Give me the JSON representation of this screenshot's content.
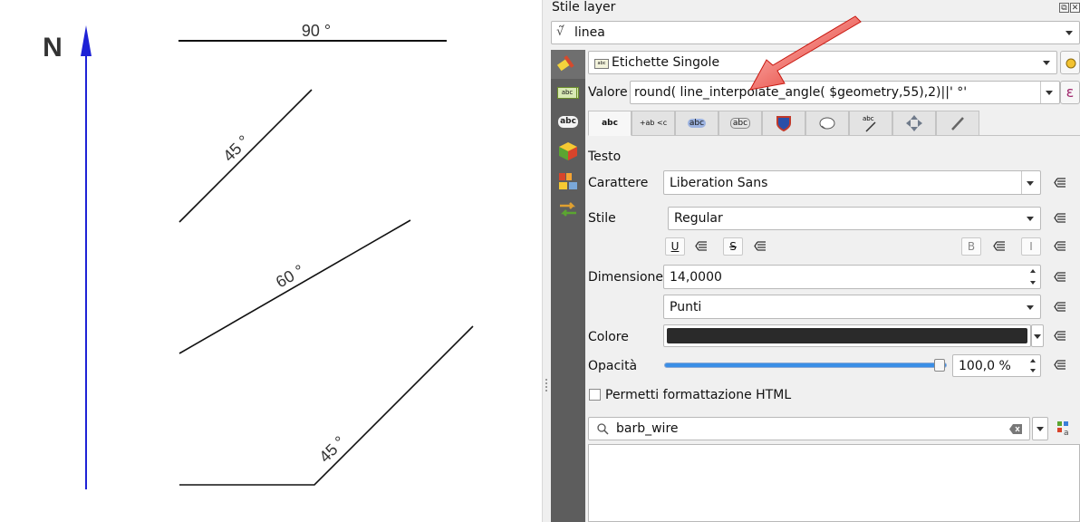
{
  "canvas": {
    "north_label": "N",
    "angle_labels": [
      "90 °",
      "45 °",
      "60 °",
      "45 °"
    ],
    "colors": {
      "north_arrow": "#1e22d6",
      "lines": "#111111"
    }
  },
  "panel": {
    "title": "Stile layer",
    "layer": {
      "icon": "line-layer-icon",
      "name": "linea"
    },
    "renderer": {
      "value": "Etichette Singole"
    },
    "value_label": "Valore",
    "value_expression": "round( line_interpolate_angle( $geometry,55),2)||' °'",
    "expression_button": "ε",
    "tabs": [
      "text",
      "formatting",
      "buffer",
      "background",
      "shadow",
      "callouts",
      "placement",
      "rendering",
      "mask"
    ],
    "section_title": "Testo",
    "font": {
      "label": "Carattere",
      "value": "Liberation Sans"
    },
    "style": {
      "label": "Stile",
      "value": "Regular"
    },
    "format_buttons": {
      "underline": "U",
      "strike": "S",
      "bold": "B",
      "italic": "I"
    },
    "size": {
      "label": "Dimensione",
      "value": "14,0000"
    },
    "units": {
      "value": "Punti"
    },
    "color": {
      "label": "Colore",
      "value": "#2a2a2a"
    },
    "opacity": {
      "label": "Opacità",
      "value": "100,0 %",
      "level": 1.0
    },
    "html_checkbox": {
      "label": "Permetti formattazione HTML",
      "checked": false
    },
    "search": {
      "value": "barb_wire"
    }
  },
  "annotation": {
    "arrow_color": "#e2231a"
  }
}
